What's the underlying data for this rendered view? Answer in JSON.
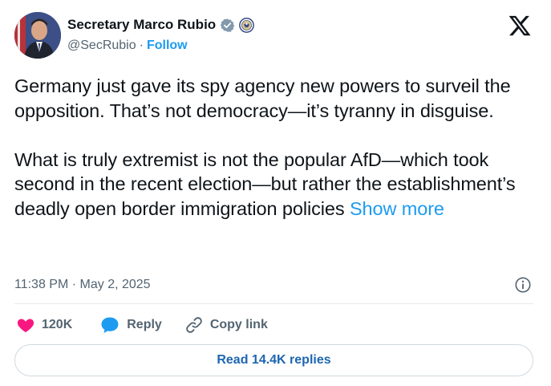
{
  "author": {
    "display_name": "Secretary Marco Rubio",
    "handle": "@SecRubio",
    "separator": "·",
    "follow_label": "Follow"
  },
  "tweet": {
    "paragraph_1": "Germany just gave its spy agency new powers to surveil the opposition.  That’s not democracy—it’s tyranny in disguise.",
    "paragraph_2": "What is truly extremist is not the popular AfD—which took second in the recent election—but rather the establishment’s deadly open border immigration policies",
    "show_more_label": "Show more",
    "timestamp": "11:38 PM · May 2, 2025"
  },
  "actions": {
    "like_count": "120K",
    "reply_label": "Reply",
    "copy_link_label": "Copy link"
  },
  "replies_button_label": "Read 14.4K replies",
  "colors": {
    "link_blue": "#1d9bf0",
    "like_red": "#f91880",
    "reply_blue": "#1d9bf0",
    "text": "#0f1419",
    "muted": "#536471",
    "verified_gray": "#829aab"
  },
  "icons": {
    "verified": "verified-badge-icon",
    "seal": "state-department-seal-icon",
    "brand": "x-logo-icon",
    "info": "info-icon",
    "like": "heart-icon",
    "reply": "speech-bubble-icon",
    "copy_link": "link-icon"
  }
}
